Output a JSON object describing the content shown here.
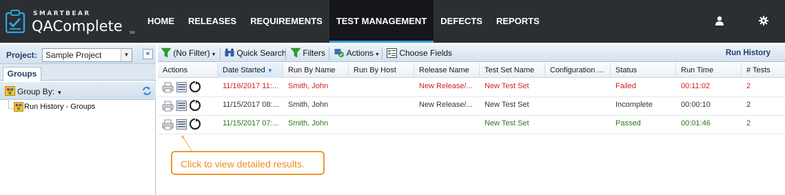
{
  "brand": {
    "small": "SMARTBEAR",
    "big": "QAComplete",
    "sm": "SM"
  },
  "nav": {
    "items": [
      "HOME",
      "RELEASES",
      "REQUIREMENTS",
      "TEST MANAGEMENT",
      "DEFECTS",
      "REPORTS"
    ],
    "active": "TEST MANAGEMENT",
    "icons": [
      "user-icon",
      "gear-icon"
    ]
  },
  "left": {
    "project_label": "Project:",
    "project_value": "Sample Project",
    "tab": "Groups",
    "group_by": "Group By:",
    "tree_item": "Run History - Groups"
  },
  "toolbar": {
    "filter": "(No Filter)",
    "quick_search": "Quick Search",
    "filters": "Filters",
    "actions": "Actions",
    "choose_fields": "Choose Fields",
    "title": "Run History"
  },
  "table": {
    "columns": [
      "Actions",
      "Date Started",
      "Run By Name",
      "Run By Host",
      "Release Name",
      "Test Set Name",
      "Configuration ...",
      "Status",
      "Run Time",
      "# Tests"
    ],
    "rows": [
      {
        "date": "11/16/2017 11:...",
        "run_by": "Smith, John",
        "host": "",
        "release": "New Release/...",
        "test_set": "New Test Set",
        "config": "",
        "status": "Failed",
        "run_time": "00:11:02",
        "tests": "2",
        "tone": "red"
      },
      {
        "date": "11/15/2017 08:...",
        "run_by": "Smith, John",
        "host": "",
        "release": "New Release/...",
        "test_set": "New Test Set",
        "config": "",
        "status": "Incomplete",
        "run_time": "00:00:10",
        "tests": "2",
        "tone": "gray"
      },
      {
        "date": "11/15/2017 07:...",
        "run_by": "Smith, John",
        "host": "",
        "release": "",
        "test_set": "New Test Set",
        "config": "",
        "status": "Passed",
        "run_time": "00:01:46",
        "tests": "2",
        "tone": "green"
      }
    ]
  },
  "callout": {
    "text": "Click to view detailed results."
  },
  "colors": {
    "nav_bg": "#2b2e33",
    "accent": "#2ea3dc",
    "failed": "#d01f1f",
    "passed": "#2a7a1a",
    "callout": "#f0962c"
  }
}
